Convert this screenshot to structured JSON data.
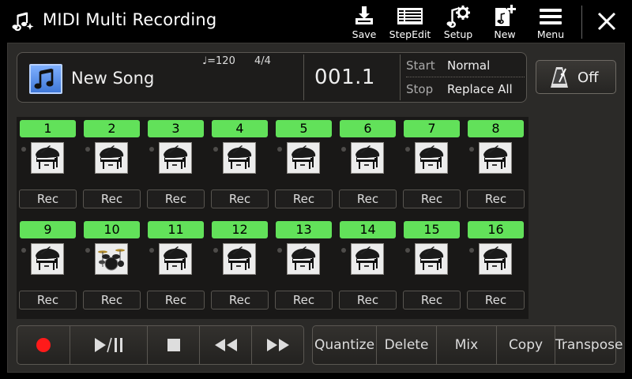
{
  "header": {
    "title": "MIDI Multi Recording",
    "app_icon": "music-note-sparkle-icon",
    "tools": [
      {
        "label": "Save",
        "icon": "save-icon"
      },
      {
        "label": "StepEdit",
        "icon": "step-edit-icon"
      },
      {
        "label": "Setup",
        "icon": "setup-icon"
      },
      {
        "label": "New",
        "icon": "new-icon"
      },
      {
        "label": "Menu",
        "icon": "menu-icon"
      }
    ],
    "close_icon": "close-icon"
  },
  "song": {
    "icon": "music-note-icon",
    "name": "New Song",
    "tempo": "♩=120",
    "time_signature": "4/4",
    "position": "001.1",
    "start_label": "Start",
    "start_value": "Normal",
    "stop_label": "Stop",
    "stop_value": "Replace All"
  },
  "metronome": {
    "icon": "metronome-icon",
    "label": "Off"
  },
  "channels": [
    {
      "number": "1",
      "voice": "grand-piano-icon",
      "rec": "Rec"
    },
    {
      "number": "2",
      "voice": "grand-piano-icon",
      "rec": "Rec"
    },
    {
      "number": "3",
      "voice": "grand-piano-icon",
      "rec": "Rec"
    },
    {
      "number": "4",
      "voice": "grand-piano-icon",
      "rec": "Rec"
    },
    {
      "number": "5",
      "voice": "grand-piano-icon",
      "rec": "Rec"
    },
    {
      "number": "6",
      "voice": "grand-piano-icon",
      "rec": "Rec"
    },
    {
      "number": "7",
      "voice": "grand-piano-icon",
      "rec": "Rec"
    },
    {
      "number": "8",
      "voice": "grand-piano-icon",
      "rec": "Rec"
    },
    {
      "number": "9",
      "voice": "grand-piano-icon",
      "rec": "Rec"
    },
    {
      "number": "10",
      "voice": "drum-kit-icon",
      "rec": "Rec"
    },
    {
      "number": "11",
      "voice": "grand-piano-icon",
      "rec": "Rec"
    },
    {
      "number": "12",
      "voice": "grand-piano-icon",
      "rec": "Rec"
    },
    {
      "number": "13",
      "voice": "grand-piano-icon",
      "rec": "Rec"
    },
    {
      "number": "14",
      "voice": "grand-piano-icon",
      "rec": "Rec"
    },
    {
      "number": "15",
      "voice": "grand-piano-icon",
      "rec": "Rec"
    },
    {
      "number": "16",
      "voice": "grand-piano-icon",
      "rec": "Rec"
    }
  ],
  "transport": [
    {
      "icon": "record-icon"
    },
    {
      "icon": "play-pause-icon"
    },
    {
      "icon": "stop-icon"
    },
    {
      "icon": "rewind-icon"
    },
    {
      "icon": "fast-forward-icon"
    }
  ],
  "actions": [
    {
      "label": "Quantize"
    },
    {
      "label": "Delete"
    },
    {
      "label": "Mix"
    },
    {
      "label": "Copy"
    },
    {
      "label": "Transpose"
    }
  ],
  "colors": {
    "channel_active": "#62e15a",
    "record": "#ff1a1a",
    "song_icon": "#5a8fe8"
  }
}
